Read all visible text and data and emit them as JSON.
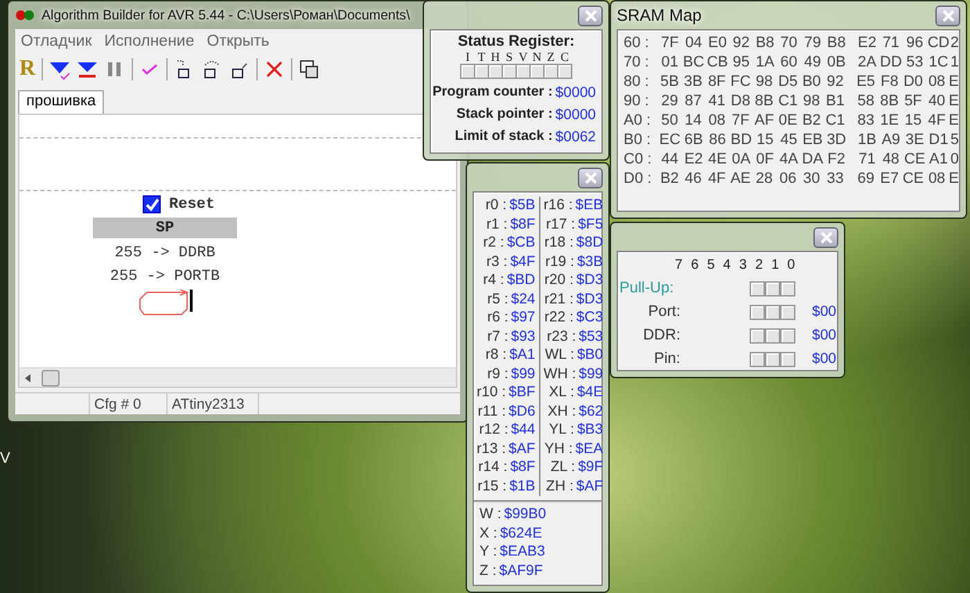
{
  "desktop": {
    "label": "V"
  },
  "main_window": {
    "title": "Algorithm Builder for AVR 5.44 - C:\\Users\\Роман\\Documents\\",
    "menu": [
      "Отладчик",
      "Исполнение",
      "Открыть"
    ],
    "toolbar_letter": "R",
    "tabs": [
      {
        "label": "прошивка",
        "selected": true
      }
    ],
    "flowchart": {
      "start_label": "Reset",
      "start_checked": true,
      "block": "SP",
      "lines": [
        "255 -> DDRB",
        "255 -> PORTB"
      ]
    },
    "status_bar": [
      "Cfg # 0",
      "ATtiny2313"
    ]
  },
  "status_window": {
    "title": "Status Register:",
    "flags": [
      {
        "label": "I",
        "checked": false
      },
      {
        "label": "T",
        "checked": false
      },
      {
        "label": "H",
        "checked": false
      },
      {
        "label": "S",
        "checked": false
      },
      {
        "label": "V",
        "checked": false
      },
      {
        "label": "N",
        "checked": false
      },
      {
        "label": "Z",
        "checked": false
      },
      {
        "label": "C",
        "checked": false
      }
    ],
    "fields": [
      {
        "label": "Program counter :",
        "value": "$0000"
      },
      {
        "label": "Stack pointer :",
        "value": "$0000"
      },
      {
        "label": "Limit of stack :",
        "value": "$0062"
      }
    ]
  },
  "sram_window": {
    "title": "SRAM Map",
    "rows": [
      {
        "address": "60 :",
        "bytes": [
          "7F",
          "04",
          "E0",
          "92",
          "B8",
          "70",
          "79",
          "B8",
          "E2",
          "71",
          "96",
          "CD",
          "2"
        ]
      },
      {
        "address": "70 :",
        "bytes": [
          "01",
          "BC",
          "CB",
          "95",
          "1A",
          "60",
          "49",
          "0B",
          "2A",
          "DD",
          "53",
          "1C",
          "1"
        ]
      },
      {
        "address": "80 :",
        "bytes": [
          "5B",
          "3B",
          "8F",
          "FC",
          "98",
          "D5",
          "B0",
          "92",
          "E5",
          "F8",
          "D0",
          "08",
          "E"
        ]
      },
      {
        "address": "90 :",
        "bytes": [
          "29",
          "87",
          "41",
          "D8",
          "8B",
          "C1",
          "98",
          "B1",
          "58",
          "8B",
          "5F",
          "40",
          "E"
        ]
      },
      {
        "address": "A0 :",
        "bytes": [
          "50",
          "14",
          "08",
          "7F",
          "AF",
          "0E",
          "B2",
          "C1",
          "83",
          "1E",
          "15",
          "4F",
          "E"
        ]
      },
      {
        "address": "B0 :",
        "bytes": [
          "EC",
          "6B",
          "86",
          "BD",
          "15",
          "45",
          "EB",
          "3D",
          "1B",
          "A9",
          "3E",
          "D1",
          "5"
        ]
      },
      {
        "address": "C0 :",
        "bytes": [
          "44",
          "E2",
          "4E",
          "0A",
          "0F",
          "4A",
          "DA",
          "F2",
          "71",
          "48",
          "CE",
          "A1",
          "0"
        ]
      },
      {
        "address": "D0 :",
        "bytes": [
          "B2",
          "46",
          "4F",
          "AE",
          "28",
          "06",
          "30",
          "33",
          "69",
          "E7",
          "CE",
          "08",
          "E"
        ]
      }
    ]
  },
  "registers_window": {
    "left": [
      {
        "name": "r0 :",
        "value": "$5B"
      },
      {
        "name": "r1 :",
        "value": "$8F"
      },
      {
        "name": "r2 :",
        "value": "$CB"
      },
      {
        "name": "r3 :",
        "value": "$4F"
      },
      {
        "name": "r4 :",
        "value": "$BD"
      },
      {
        "name": "r5 :",
        "value": "$24"
      },
      {
        "name": "r6 :",
        "value": "$97"
      },
      {
        "name": "r7 :",
        "value": "$93"
      },
      {
        "name": "r8 :",
        "value": "$A1"
      },
      {
        "name": "r9 :",
        "value": "$99"
      },
      {
        "name": "r10 :",
        "value": "$BF"
      },
      {
        "name": "r11 :",
        "value": "$D6"
      },
      {
        "name": "r12 :",
        "value": "$44"
      },
      {
        "name": "r13 :",
        "value": "$AF"
      },
      {
        "name": "r14 :",
        "value": "$8F"
      },
      {
        "name": "r15 :",
        "value": "$1B"
      }
    ],
    "right": [
      {
        "name": "r16 :",
        "value": "$EB"
      },
      {
        "name": "r17 :",
        "value": "$F5"
      },
      {
        "name": "r18 :",
        "value": "$8D"
      },
      {
        "name": "r19 :",
        "value": "$3B"
      },
      {
        "name": "r20 :",
        "value": "$D3"
      },
      {
        "name": "r21 :",
        "value": "$D3"
      },
      {
        "name": "r22 :",
        "value": "$C3"
      },
      {
        "name": "r23 :",
        "value": "$53"
      },
      {
        "name": "WL :",
        "value": "$B0"
      },
      {
        "name": "WH :",
        "value": "$99"
      },
      {
        "name": "XL :",
        "value": "$4E"
      },
      {
        "name": "XH :",
        "value": "$62"
      },
      {
        "name": "YL :",
        "value": "$B3"
      },
      {
        "name": "YH :",
        "value": "$EA"
      },
      {
        "name": "ZL :",
        "value": "$9F"
      },
      {
        "name": "ZH :",
        "value": "$AF"
      }
    ],
    "pairs": [
      {
        "name": "W :",
        "value": "$99B0"
      },
      {
        "name": "X :",
        "value": "$624E"
      },
      {
        "name": "Y :",
        "value": "$EAB3"
      },
      {
        "name": "Z :",
        "value": "$AF9F"
      }
    ]
  },
  "port_window": {
    "bits": [
      "7",
      "6",
      "5",
      "4",
      "3",
      "2",
      "1",
      "0"
    ],
    "rows": [
      {
        "kind": "pullup",
        "label": "Pull-Up:",
        "bits": [
          false,
          false,
          false
        ]
      },
      {
        "kind": "register",
        "label": "Port:",
        "bits": [
          false,
          false,
          false
        ],
        "value": "$00"
      },
      {
        "kind": "register",
        "label": "DDR:",
        "bits": [
          false,
          false,
          false
        ],
        "value": "$00"
      },
      {
        "kind": "register",
        "label": "Pin:",
        "bits": [
          false,
          false,
          false
        ],
        "value": "$00"
      }
    ]
  }
}
